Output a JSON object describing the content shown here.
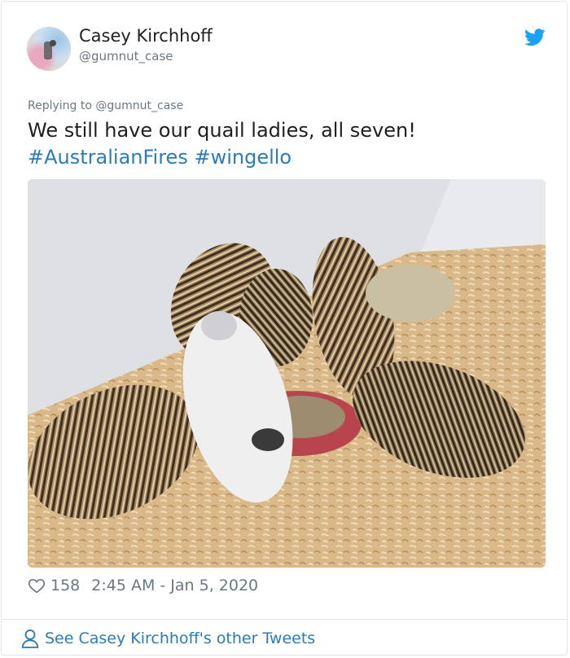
{
  "author": {
    "name": "Casey Kirchhoff",
    "handle": "@gumnut_case"
  },
  "reply": {
    "prefix": "Replying to",
    "to": "@gumnut_case"
  },
  "tweet": {
    "text": "We still have our quail ladies, all seven!",
    "hashtag1": "#AustralianFires",
    "hashtag2": "#wingello"
  },
  "meta": {
    "likes": "158",
    "timestamp": "2:45 AM - Jan 5, 2020"
  },
  "link": {
    "label": "See Casey Kirchhoff's other Tweets"
  },
  "colors": {
    "accent": "#2b7bb9",
    "muted": "#697882",
    "twitter_blue": "#1da1f2"
  },
  "icons": {
    "brand": "twitter-bird-icon",
    "like": "heart-icon",
    "profile": "person-icon"
  }
}
